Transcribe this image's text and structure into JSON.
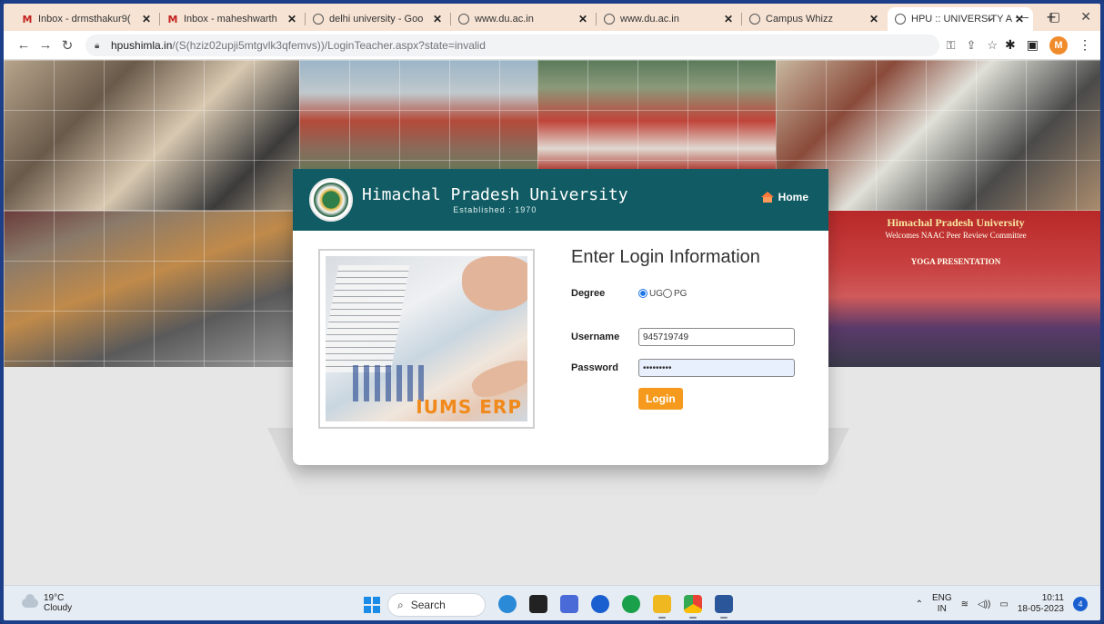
{
  "browser": {
    "tabs": [
      {
        "label": "Inbox - drmsthakur9(",
        "icon": "gmail-icon",
        "active": false
      },
      {
        "label": "Inbox - maheshwarth",
        "icon": "gmail-icon",
        "active": false
      },
      {
        "label": "delhi university - Goo",
        "icon": "globe-icon",
        "active": false
      },
      {
        "label": "www.du.ac.in",
        "icon": "globe-icon",
        "active": false
      },
      {
        "label": "www.du.ac.in",
        "icon": "globe-icon",
        "active": false
      },
      {
        "label": "Campus Whizz",
        "icon": "globe-icon",
        "active": false
      },
      {
        "label": "HPU :: UNIVERSITY A",
        "icon": "globe-icon",
        "active": true
      }
    ],
    "new_tab": "+",
    "url_host": "hpushimla.in",
    "url_path": "/(S(hziz02upji5mtgvlk3qfemvs))/LoginTeacher.aspx?state=invalid",
    "profile_initial": "M"
  },
  "header": {
    "university": "Himachal Pradesh University",
    "established": "Established : 1970",
    "home_label": "Home"
  },
  "collage": {
    "banner_title": "Himachal Pradesh University",
    "banner_sub": "Welcomes NAAC Peer Review Committee",
    "banner_event": "YOGA PRESENTATION"
  },
  "illustration": {
    "brand_a": "IUMS",
    "brand_b": "ERP"
  },
  "login": {
    "title": "Enter Login Information",
    "degree_label": "Degree",
    "options": [
      "UG",
      "PG"
    ],
    "selected": "UG",
    "username_label": "Username",
    "username_value": "945719749",
    "password_label": "Password",
    "password_value": "•••••••••",
    "button": "Login"
  },
  "taskbar": {
    "temp": "19°C",
    "condition": "Cloudy",
    "search": "Search",
    "lang_top": "ENG",
    "lang_bottom": "IN",
    "time": "10:11",
    "date": "18-05-2023",
    "notifications": "4"
  }
}
